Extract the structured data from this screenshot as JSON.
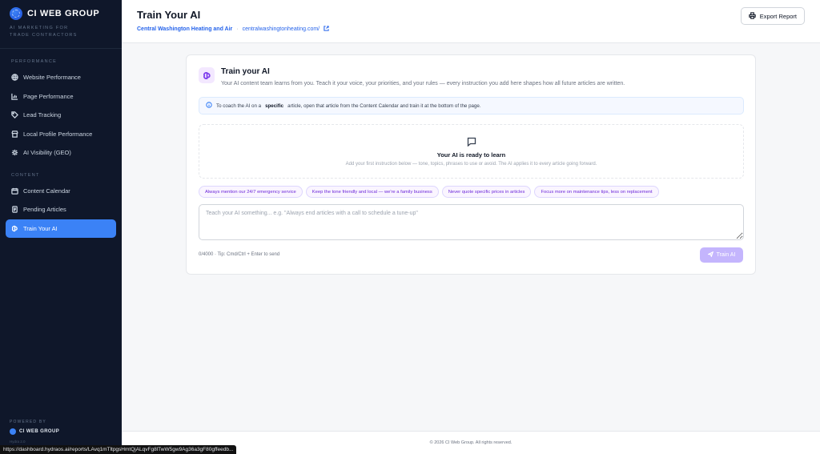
{
  "brand": {
    "name": "CI WEB GROUP",
    "tagline": "AI MARKETING FOR TRADE CONTRACTORS"
  },
  "sidebar": {
    "sections": [
      {
        "label": "PERFORMANCE",
        "items": [
          {
            "label": "Website Performance",
            "icon": "globe-icon"
          },
          {
            "label": "Page Performance",
            "icon": "bar-chart-icon"
          },
          {
            "label": "Lead Tracking",
            "icon": "tag-icon"
          },
          {
            "label": "Local Profile Performance",
            "icon": "storefront-icon"
          },
          {
            "label": "AI Visibility (GEO)",
            "icon": "sparkles-icon"
          }
        ]
      },
      {
        "label": "CONTENT",
        "items": [
          {
            "label": "Content Calendar",
            "icon": "calendar-icon"
          },
          {
            "label": "Pending Articles",
            "icon": "article-icon"
          },
          {
            "label": "Train Your AI",
            "icon": "brain-icon",
            "active": true
          }
        ]
      }
    ],
    "powered_label": "POWERED BY",
    "powered_name": "CI WEB GROUP",
    "version": "Hydra 2.0"
  },
  "header": {
    "title": "Train Your AI",
    "client_name": "Central Washington Heating and Air",
    "separator": "·",
    "client_url": "centralwashingtonheating.com/",
    "export_label": "Export Report"
  },
  "card": {
    "title": "Train your AI",
    "description": "Your AI content team learns from you. Teach it your voice, your priorities, and your rules — every instruction you add here shapes how all future articles are written.",
    "info_prefix": "To coach the AI on a",
    "info_bold": "specific",
    "info_suffix": "article, open that article from the Content Calendar and train it at the bottom of the page.",
    "empty_title": "Your AI is ready to learn",
    "empty_sub": "Add your first instruction below — tone, topics, phrases to use or avoid. The AI applies it to every article going forward.",
    "chips": [
      "Always mention our 24/7 emergency service",
      "Keep the tone friendly and local — we're a family business",
      "Never quote specific prices in articles",
      "Focus more on maintenance tips, less on replacement"
    ],
    "input_placeholder": "Teach your AI something... e.g. \"Always end articles with a call to schedule a tune-up\"",
    "counter": "0/4000 · Tip: Cmd/Ctrl + Enter to send",
    "train_label": "Train AI"
  },
  "footer": {
    "text": "© 2026 CI Web Group. All rights reserved."
  },
  "status_bar": {
    "url": "https://dashboard.hydraos.ai/reports/LAvq1mTltpgsHmtQjALqvFg8lTwW5gw9Ag36a3gF80gffeedb..."
  },
  "colors": {
    "sidebar_bg": "#0f172a",
    "accent": "#3b82f6",
    "purple": "#7c3aed"
  }
}
